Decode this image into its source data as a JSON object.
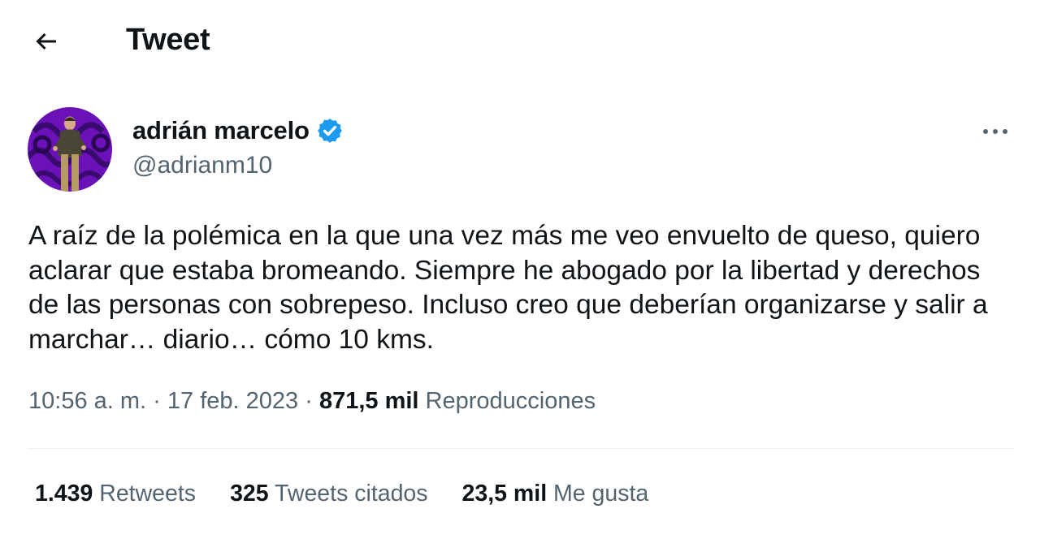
{
  "header": {
    "title": "Tweet",
    "back_icon": "arrow-left-icon"
  },
  "author": {
    "display_name": "adrián marcelo",
    "handle": "@adrianm10",
    "verified": true,
    "verified_color": "#1d9bf0",
    "avatar_bg": "#6a12b8"
  },
  "tweet": {
    "text": "A raíz de la polémica en la que una vez más me veo envuelto de queso, quiero aclarar que estaba bromeando. Siempre he abogado por la libertad y derechos de las personas con sobrepeso. Incluso creo que deberían organizarse y salir a marchar… diario… cómo 10 kms.",
    "time": "10:56 a. m.",
    "separator": "·",
    "date": "17 feb. 2023",
    "views_count": "871,5 mil",
    "views_label": "Reproducciones"
  },
  "stats": {
    "retweets_count": "1.439",
    "retweets_label": "Retweets",
    "quotes_count": "325",
    "quotes_label": "Tweets citados",
    "likes_count": "23,5 mil",
    "likes_label": "Me gusta"
  },
  "colors": {
    "text": "#0f1419",
    "secondary": "#536471",
    "divider": "#eff3f4"
  }
}
